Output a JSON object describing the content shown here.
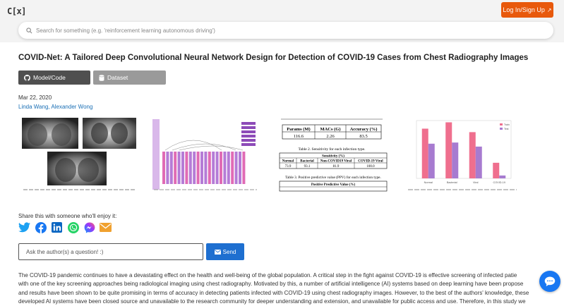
{
  "header": {
    "logo": "C[x]",
    "login_label": "Log In/Sign Up",
    "search_placeholder": "Search for something (e.g. 'reinforcement learning autonomous driving')"
  },
  "paper": {
    "title": "COVID-Net: A Tailored Deep Convolutional Neural Network Design for Detection of COVID-19 Cases from Chest Radiography Images",
    "buttons": {
      "model_code": "Model/Code",
      "dataset": "Dataset"
    },
    "date": "Mar 22, 2020",
    "authors": [
      "Linda Wang",
      "Alexander Wong"
    ],
    "authors_sep": ", "
  },
  "thumbnails": {
    "thumb3": {
      "table1_headers": [
        "Params (M)",
        "MACs (G)",
        "Accuracy (%)"
      ],
      "table1_values": [
        "116.6",
        "2.26",
        "83.5"
      ],
      "table2_caption": "Table 2. Sensitivity for each infection type.",
      "table2_group": "Sensitivity (%)",
      "table2_headers": [
        "Normal",
        "Bacterial",
        "Non-COVID19 Viral",
        "COVID-19 Viral"
      ],
      "table2_values": [
        "73.9",
        "93.1",
        "81.9",
        "100.0"
      ],
      "table3_caption": "Table 3. Positive predictive value (PPV) for each infection type.",
      "table3_group": "Positive Predictive Value (%)"
    },
    "thumb4": {
      "chart_data": {
        "type": "bar",
        "categories": [
          "Normal",
          "Bacterial",
          "Viral",
          "COVID-19"
        ],
        "series": [
          {
            "name": "Train",
            "values": [
              86,
              97,
              80,
              27
            ]
          },
          {
            "name": "Test",
            "values": [
              60,
              62,
              55,
              5
            ]
          }
        ],
        "colors": [
          "#ef6f8e",
          "#a77bd0"
        ],
        "ylim": [
          0,
          100
        ]
      }
    }
  },
  "share": {
    "label": "Share this with someone who'll enjoy it:",
    "icons": [
      "twitter-icon",
      "facebook-icon",
      "linkedin-icon",
      "whatsapp-icon",
      "messenger-icon",
      "email-icon"
    ]
  },
  "ask": {
    "placeholder": "Ask the author(s) a question! :)",
    "send_label": "Send"
  },
  "abstract": {
    "lines": [
      "The COVID-19 pandemic continues to have a devastating effect on the health and well-being of the global population. A critical step in the fight against COVID-19 is effective screening of infected patie",
      "with one of the key screening approaches being radiological imaging using chest radiography. Motivated by this, a number of artificial intelligence (AI) systems based on deep learning have been propose",
      "and results have been shown to be quite promising in terms of accuracy in detecting patients infected with COVID-19 using chest radiography images. However, to the best of the authors' knowledge, these",
      "developed AI systems have been closed source and unavailable to the research community for deeper understanding and extension, and unavailable for public access and use. Therefore, in this study we"
    ]
  },
  "colors": {
    "accent": "#e8590c",
    "link": "#1a6fb5",
    "send": "#1e6fd0",
    "chat": "#1877f2"
  }
}
